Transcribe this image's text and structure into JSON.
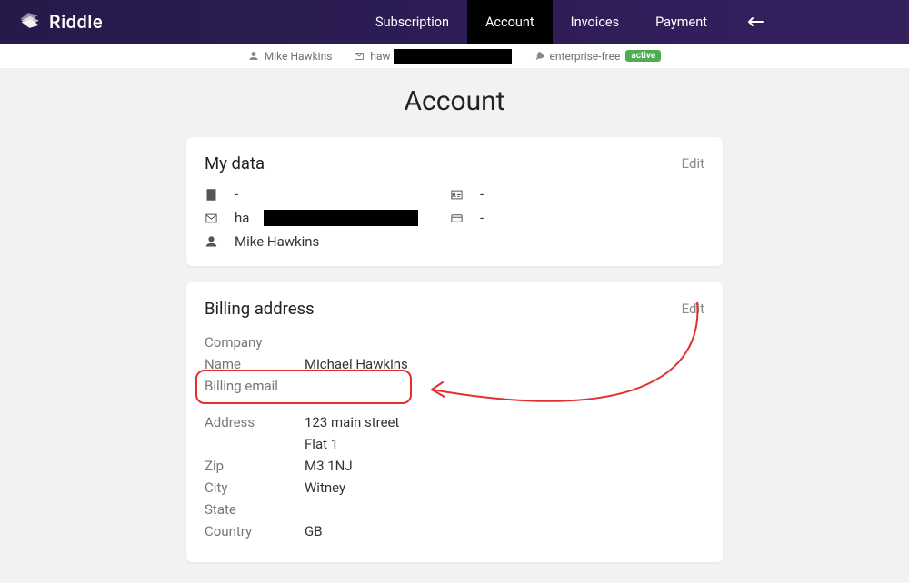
{
  "brand": {
    "name": "Riddle"
  },
  "nav": {
    "items": [
      {
        "label": "Subscription"
      },
      {
        "label": "Account",
        "active": true
      },
      {
        "label": "Invoices"
      },
      {
        "label": "Payment"
      }
    ]
  },
  "subbar": {
    "user": "Mike Hawkins",
    "email_prefix": "haw",
    "plan": "enterprise-free",
    "status": "active"
  },
  "page": {
    "title": "Account"
  },
  "mydata": {
    "title": "My data",
    "edit": "Edit",
    "company": "-",
    "email_prefix": "ha",
    "name": "Mike Hawkins",
    "id": "-",
    "card": "-"
  },
  "billing": {
    "title": "Billing address",
    "edit": "Edit",
    "labels": {
      "company": "Company",
      "name": "Name",
      "billing_email": "Billing email",
      "address": "Address",
      "zip": "Zip",
      "city": "City",
      "state": "State",
      "country": "Country"
    },
    "values": {
      "company": "",
      "name": "Michael Hawkins",
      "billing_email": "",
      "address_line1": "123 main street",
      "address_line2": "Flat 1",
      "zip": "M3 1NJ",
      "city": "Witney",
      "state": "",
      "country": "GB"
    }
  }
}
